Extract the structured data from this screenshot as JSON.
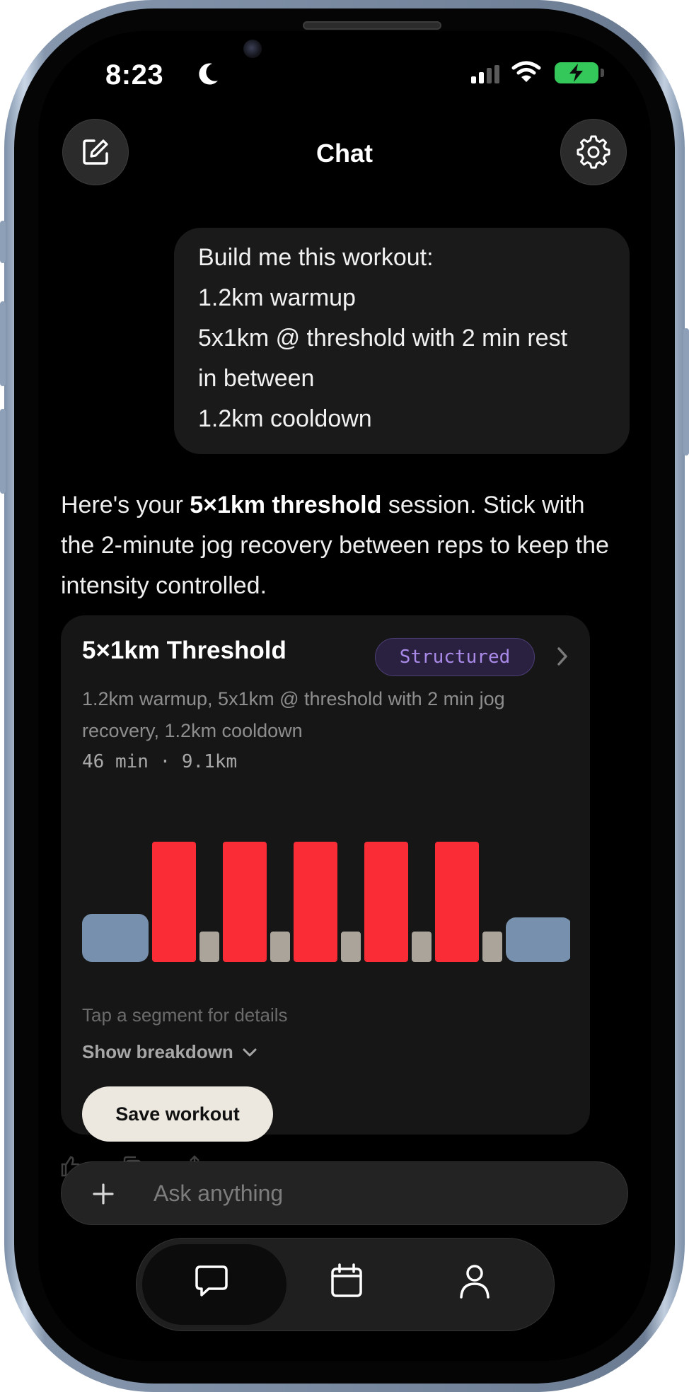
{
  "status": {
    "time": "8:23"
  },
  "header": {
    "title": "Chat"
  },
  "user_message": {
    "lines": [
      "Build me this workout:",
      "1.2km warmup",
      "5x1km @ threshold with 2 min rest",
      "in between",
      "1.2km cooldown"
    ]
  },
  "assistant_message": {
    "intro": "Here's your ",
    "bold": "5×1km threshold",
    "rest": " session. Stick with the 2-minute jog recovery between reps to keep the intensity controlled."
  },
  "workout_card": {
    "title": "5×1km Threshold",
    "badge": "Structured",
    "description": "1.2km warmup, 5x1km @ threshold with 2 min jog recovery, 1.2km cooldown",
    "meta": "46 min · 9.1km",
    "segments": [
      {
        "type": "warmup",
        "intensity": 0.4
      },
      {
        "type": "interval",
        "intensity": 1.0
      },
      {
        "type": "recovery",
        "intensity": 0.25
      },
      {
        "type": "interval",
        "intensity": 1.0
      },
      {
        "type": "recovery",
        "intensity": 0.25
      },
      {
        "type": "interval",
        "intensity": 1.0
      },
      {
        "type": "recovery",
        "intensity": 0.25
      },
      {
        "type": "interval",
        "intensity": 1.0
      },
      {
        "type": "recovery",
        "intensity": 0.25
      },
      {
        "type": "interval",
        "intensity": 1.0
      },
      {
        "type": "recovery",
        "intensity": 0.25
      },
      {
        "type": "cooldown",
        "intensity": 0.37
      }
    ],
    "segment_colors": {
      "warmup": "#7790ad",
      "interval": "#fa2d37",
      "recovery": "#aaa49b",
      "cooldown": "#7790ad"
    },
    "tap_hint": "Tap a segment for details",
    "breakdown_label": "Show breakdown",
    "save_label": "Save workout"
  },
  "composer": {
    "placeholder": "Ask anything"
  },
  "tabs": [
    {
      "name": "chat",
      "icon": "chat-bubble-icon",
      "active": true
    },
    {
      "name": "calendar",
      "icon": "calendar-icon",
      "active": false
    },
    {
      "name": "profile",
      "icon": "person-icon",
      "active": false
    }
  ],
  "colors": {
    "accent_badge": "#a98ae8",
    "battery": "#34c759"
  }
}
